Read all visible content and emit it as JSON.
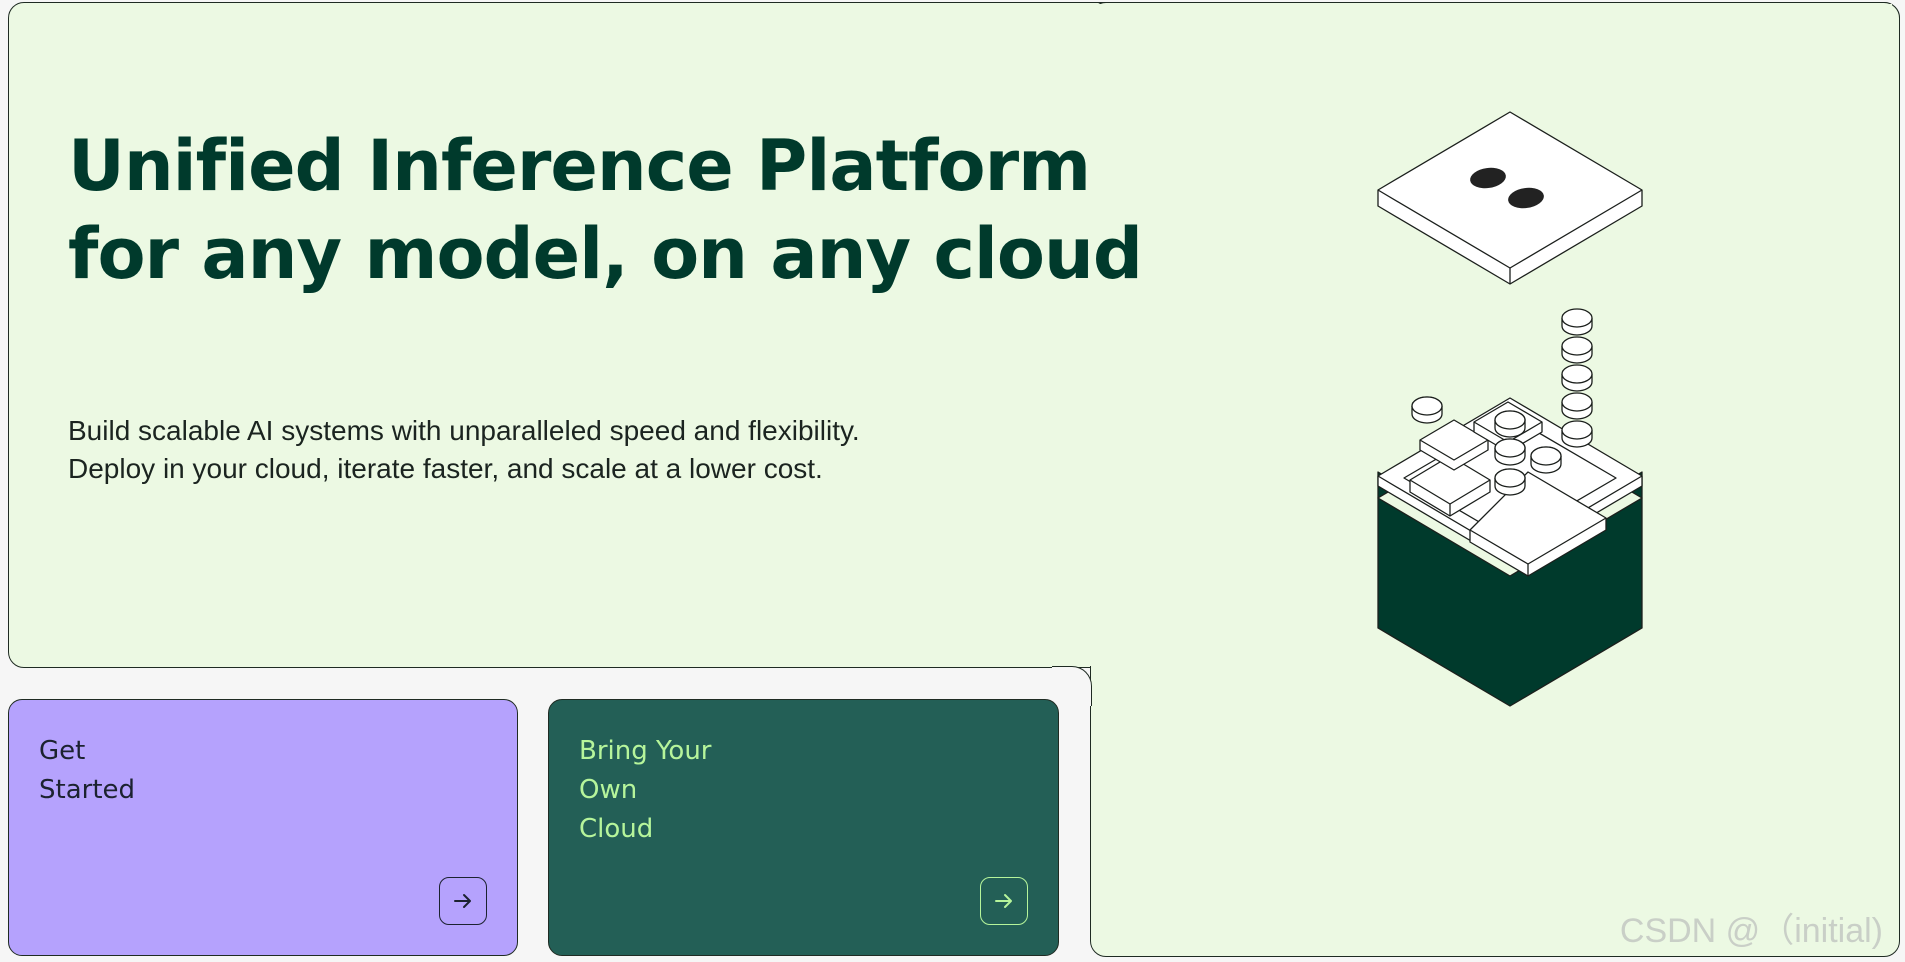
{
  "hero": {
    "headline_line1": "Unified Inference Platform",
    "headline_line2": "for any model, on any cloud",
    "subtitle_line1": "Build scalable AI systems with unparalleled speed and flexibility.",
    "subtitle_line2": "Deploy in your cloud, iterate faster, and scale at a lower cost."
  },
  "cards": {
    "get_started": {
      "line1": "Get",
      "line2": "Started",
      "icon": "arrow-right-icon",
      "color": "#b5a2fd"
    },
    "byoc": {
      "line1": "Bring Your",
      "line2": "Own",
      "line3": "Cloud",
      "icon": "arrow-right-icon",
      "color": "#235f56"
    }
  },
  "illustration": {
    "icon": "isometric-cloud-server-icon"
  },
  "watermark": {
    "text": "CSDN @（initial)"
  },
  "colors": {
    "background": "#ecf9e3",
    "heading": "#003a2c",
    "server_body": "#003a2c",
    "byoc_text": "#b6f59b"
  }
}
